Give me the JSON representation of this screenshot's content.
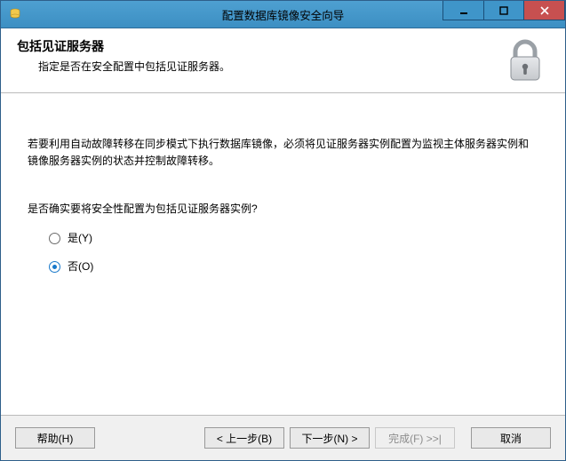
{
  "window": {
    "title": "配置数据库镜像安全向导"
  },
  "header": {
    "title": "包括见证服务器",
    "subtitle": "指定是否在安全配置中包括见证服务器。",
    "icon_name": "padlock-icon"
  },
  "body": {
    "intro": "若要利用自动故障转移在同步模式下执行数据库镜像，必须将见证服务器实例配置为监视主体服务器实例和镜像服务器实例的状态并控制故障转移。",
    "question": "是否确实要将安全性配置为包括见证服务器实例?",
    "options": {
      "yes": {
        "label": "是(Y)",
        "checked": false
      },
      "no": {
        "label": "否(O)",
        "checked": true
      }
    }
  },
  "buttons": {
    "help": "帮助(H)",
    "back": "< 上一步(B)",
    "next": "下一步(N) >",
    "finish": "完成(F) >>|",
    "cancel": "取消"
  }
}
